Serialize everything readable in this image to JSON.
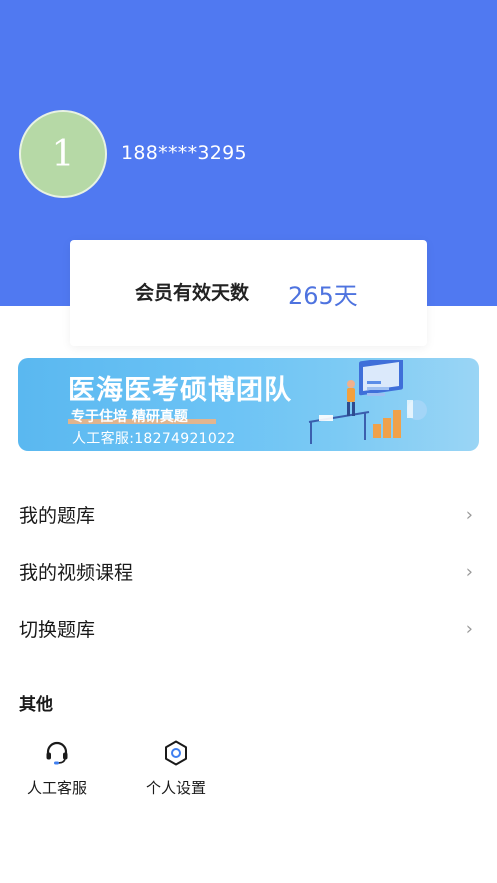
{
  "colors": {
    "header": "#5079f1",
    "accent": "#4e73df"
  },
  "profile": {
    "avatar_text": "1",
    "phone": "188****3295"
  },
  "membership": {
    "label": "会员有效天数",
    "days": "265天"
  },
  "banner": {
    "title": "医海医考硕博团队",
    "subtitle": "专于住培 精研真题",
    "service": "人工客服:18274921022"
  },
  "menu": {
    "items": [
      {
        "label": "我的题库"
      },
      {
        "label": "我的视频课程"
      },
      {
        "label": "切换题库"
      }
    ]
  },
  "others": {
    "title": "其他",
    "items": [
      {
        "label": "人工客服",
        "icon": "headset-icon"
      },
      {
        "label": "个人设置",
        "icon": "gear-icon"
      }
    ]
  }
}
